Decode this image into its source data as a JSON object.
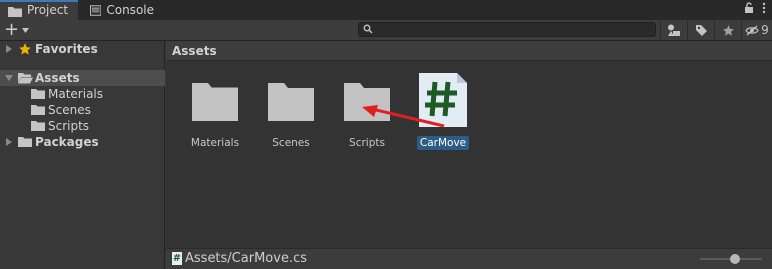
{
  "tabs": [
    {
      "label": "Project",
      "icon": "folder-icon",
      "active": true
    },
    {
      "label": "Console",
      "icon": "console-icon",
      "active": false
    }
  ],
  "toolbar": {
    "add_label": "+",
    "search_placeholder": "",
    "hidden_count": "9"
  },
  "sidebar": {
    "items": [
      {
        "label": "Favorites",
        "icon": "star-icon"
      },
      {
        "label": "Assets",
        "icon": "folder-open-icon"
      },
      {
        "label": "Materials",
        "icon": "folder-icon"
      },
      {
        "label": "Scenes",
        "icon": "folder-icon"
      },
      {
        "label": "Scripts",
        "icon": "folder-icon"
      },
      {
        "label": "Packages",
        "icon": "folder-icon"
      }
    ]
  },
  "main": {
    "title": "Assets",
    "assets": [
      {
        "label": "Materials",
        "type": "folder"
      },
      {
        "label": "Scenes",
        "type": "folder"
      },
      {
        "label": "Scripts",
        "type": "folder"
      },
      {
        "label": "CarMove",
        "type": "csharp-script",
        "selected": true
      }
    ]
  },
  "footer": {
    "path": "Assets/CarMove.cs"
  },
  "colors": {
    "accent": "#3a79bb",
    "selection": "#2c5d87",
    "arrow": "#e02020",
    "script_hash": "#1d5a24"
  }
}
